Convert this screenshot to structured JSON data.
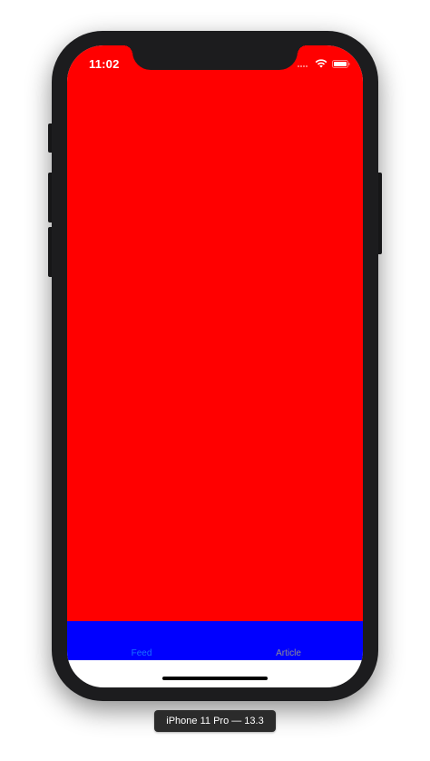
{
  "status_bar": {
    "time": "11:02"
  },
  "colors": {
    "content_background": "#ff0000",
    "tabbar_background": "#0000ff",
    "tab_selected": "#1a73ff",
    "tab_unselected": "#8e8e93"
  },
  "tab_bar": {
    "tabs": [
      {
        "label": "Feed",
        "selected": true
      },
      {
        "label": "Article",
        "selected": false
      }
    ]
  },
  "device_label": "iPhone 11 Pro — 13.3"
}
